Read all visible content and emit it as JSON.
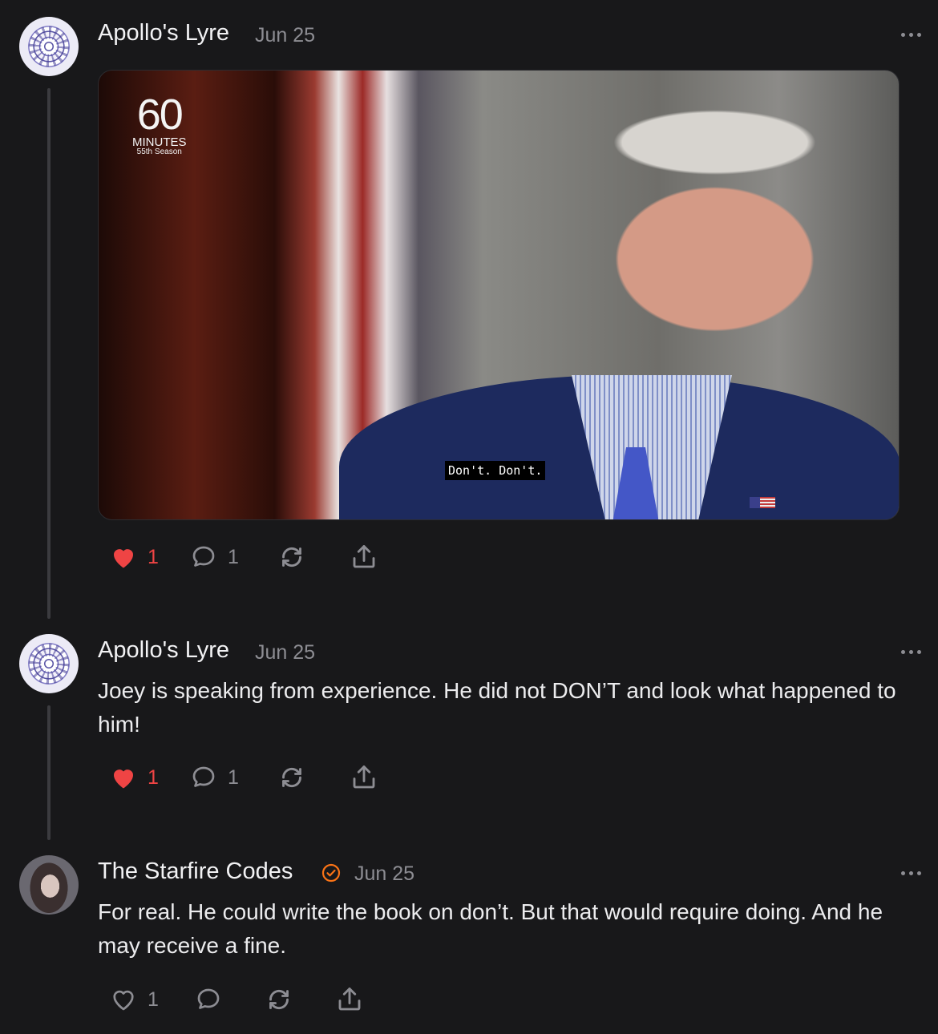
{
  "posts": [
    {
      "author": "Apollo's Lyre",
      "date": "Jun 25",
      "avatar_icon": "mandala-avatar",
      "media": {
        "logo_number": "60",
        "logo_text": "MINUTES",
        "logo_season": "55th Season",
        "caption": "Don't. Don't."
      },
      "likes": "1",
      "liked": true,
      "comments": "1"
    },
    {
      "author": "Apollo's Lyre",
      "date": "Jun 25",
      "avatar_icon": "mandala-avatar",
      "text": "Joey is speaking from experience. He did not DON’T and look what happened to him!",
      "likes": "1",
      "liked": true,
      "comments": "1"
    },
    {
      "author": "The Starfire Codes",
      "verified": true,
      "date": "Jun 25",
      "avatar_icon": "profile-photo-avatar",
      "text": "For real. He could write the book on don’t. But that would require doing. And he may receive a fine.",
      "likes": "1",
      "liked": false,
      "comments": ""
    }
  ],
  "colors": {
    "background": "#18181a",
    "like_active": "#ef4444",
    "verified_badge": "#f97316",
    "muted": "#8d8d93"
  }
}
